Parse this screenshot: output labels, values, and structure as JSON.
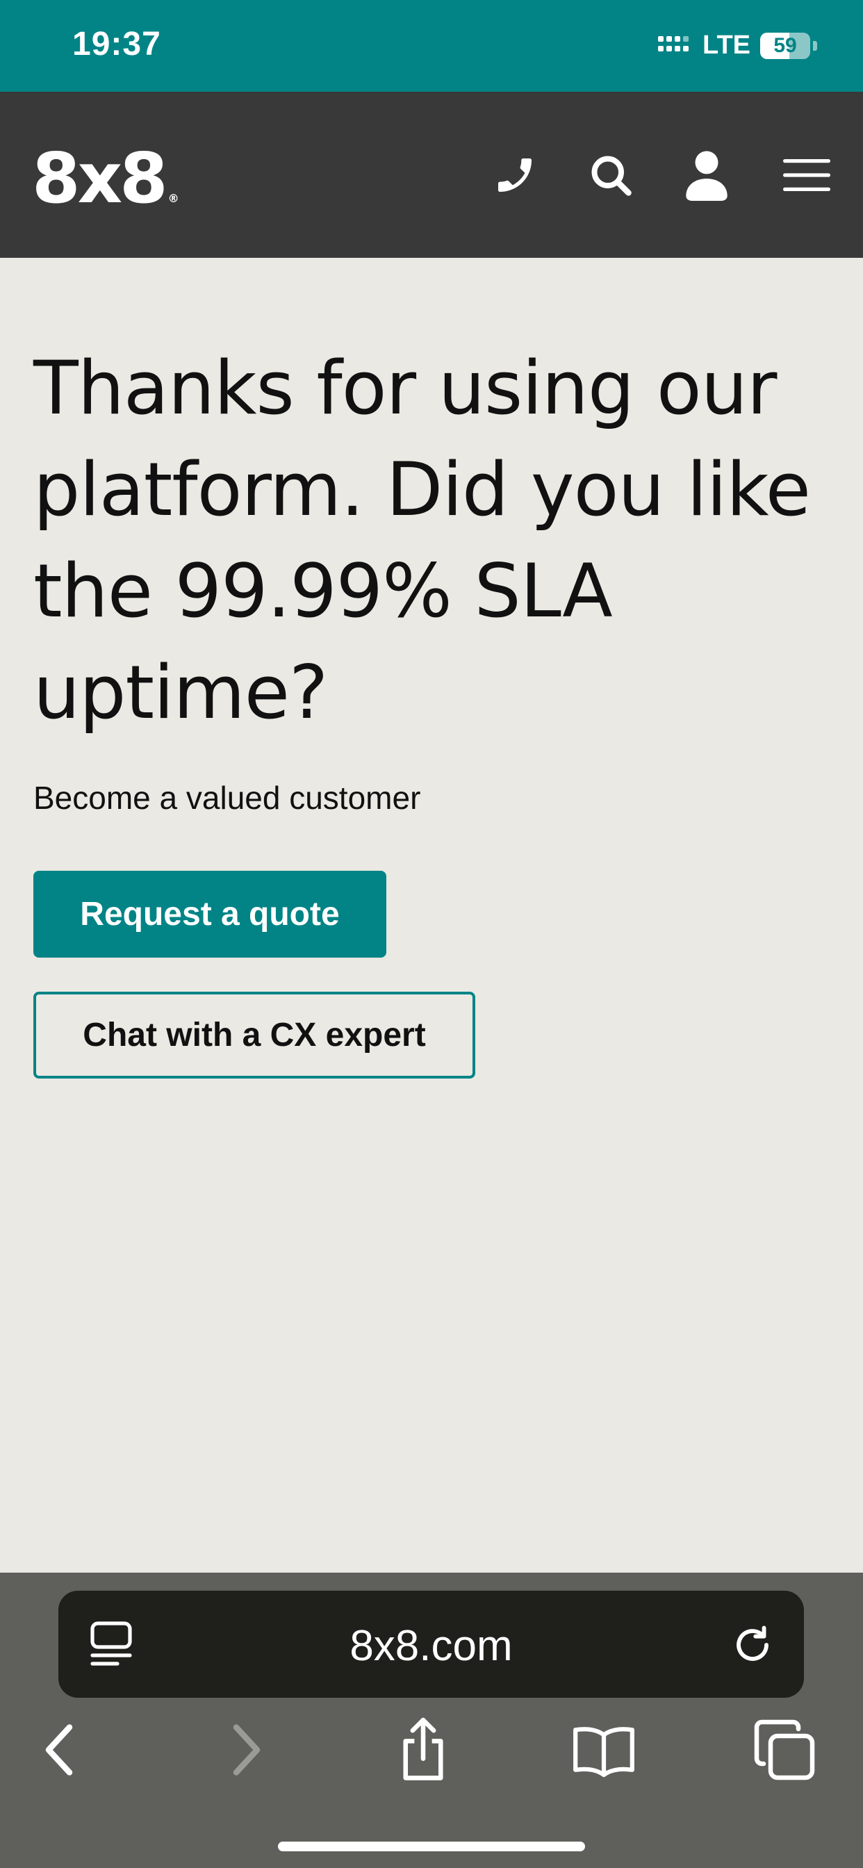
{
  "status_bar": {
    "time": "19:37",
    "network": "LTE",
    "battery_percent": "59",
    "battery_level": 0.59
  },
  "header": {
    "logo": "8x8",
    "logo_mark": "®",
    "icons": [
      "phone-icon",
      "search-icon",
      "user-icon",
      "menu-icon"
    ]
  },
  "main": {
    "headline": "Thanks for using our platform. Did you like the 99.99% SLA uptime?",
    "subtitle": "Become a valued customer",
    "primary_button": "Request a quote",
    "secondary_button": "Chat with a CX expert"
  },
  "browser": {
    "url": "8x8.com",
    "toolbar_icons": [
      "back-icon",
      "forward-icon",
      "share-icon",
      "bookmarks-icon",
      "tabs-icon"
    ]
  },
  "colors": {
    "accent": "#028486",
    "header_bg": "#393939",
    "page_bg": "#EAE9E3",
    "browser_chrome": "#5F5F5C",
    "address_bar": "#1F1F1C"
  }
}
